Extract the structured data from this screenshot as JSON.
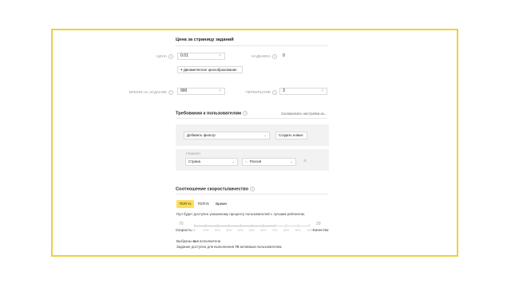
{
  "price_section": {
    "title": "Цена за страницу заданий",
    "price_label": "ЦЕНА",
    "price_value": "0.01",
    "delay_label": "НАДБАВКА",
    "delay_value": "0",
    "dynamic_pricing_button": "Динамическое ценообразование",
    "time_label": "ВРЕМЯ НА ЗАДАНИЕ",
    "time_value": "900",
    "overlap_label": "ПЕРЕКРЫТИЕ",
    "overlap_value": "3"
  },
  "requirements_section": {
    "title": "Требования к пользователям",
    "copy_link": "Скопировать настройки из...",
    "add_filter_select": "Добавить фильтр",
    "create_new_button": "Создать новые",
    "rule_label": "ПРАВИЛО",
    "country_select": "Страна",
    "operator": "=",
    "country_value": "Россия"
  },
  "speed_section": {
    "title": "Соотношение скорость/качество",
    "tabs": [
      "ТОП %",
      "ТОП N",
      "Время"
    ],
    "description": "Пул будет доступен указанному проценту пользователей с лучшим рейтингом.",
    "left_value": "70",
    "left_label": "Скорость",
    "right_value": "20",
    "right_label": "Качество",
    "ticks": [
      "0%",
      "10%",
      "20%",
      "30%",
      "40%",
      "50%",
      "60%",
      "70%",
      "80%",
      "90%",
      "100%"
    ],
    "slider_level_percent": 70,
    "selected_text_prefix": "Выбраны",
    "selected_text_bold": "все",
    "selected_text_suffix": "исполнители",
    "available_prefix": "Задание доступно для выполнения",
    "available_bold": "70",
    "available_suffix": "активным пользователям."
  },
  "colors": {
    "frame": "#ecd23a",
    "active_tab": "#ffdd57"
  }
}
